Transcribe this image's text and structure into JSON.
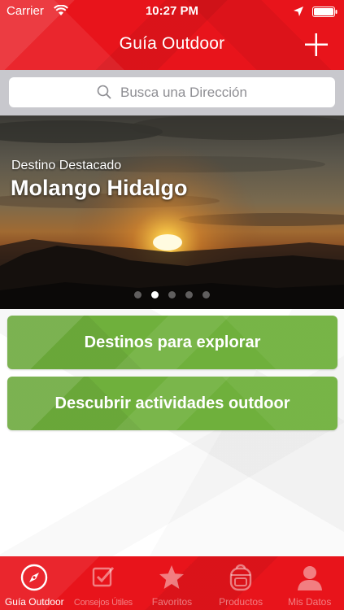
{
  "status_bar": {
    "carrier": "Carrier",
    "time": "10:27 PM"
  },
  "nav": {
    "title": "Guía Outdoor",
    "add_icon": "plus-icon"
  },
  "search": {
    "placeholder": "Busca una Dirección",
    "icon": "search-icon"
  },
  "featured": {
    "subtitle": "Destino Destacado",
    "title": "Molango Hidalgo",
    "pages": 5,
    "active_page": 2
  },
  "actions": [
    {
      "label": "Destinos para explorar"
    },
    {
      "label": "Descubrir actividades outdoor"
    }
  ],
  "tabs": [
    {
      "label": "Guía Outdoor",
      "icon": "compass-icon",
      "active": true
    },
    {
      "label": "Consejos Útiles",
      "icon": "checkbox-icon",
      "active": false
    },
    {
      "label": "Favoritos",
      "icon": "star-icon",
      "active": false
    },
    {
      "label": "Productos",
      "icon": "backpack-icon",
      "active": false
    },
    {
      "label": "Mis Datos",
      "icon": "user-icon",
      "active": false
    }
  ],
  "colors": {
    "brand_red": "#e8141b",
    "action_green": "#6fb03c",
    "search_bg": "#c8c8cd"
  }
}
